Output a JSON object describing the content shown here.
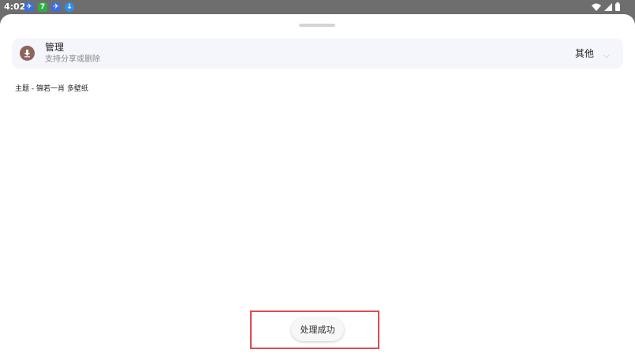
{
  "status_bar": {
    "time": "4:02",
    "notification_icons": [
      {
        "name": "app-bird-icon",
        "color": "#3d6fd8",
        "glyph": "✈"
      },
      {
        "name": "app-seven-icon",
        "color": "#2fae46",
        "glyph": "7"
      },
      {
        "name": "app-bird-icon",
        "color": "#3d6fd8",
        "glyph": "✈"
      },
      {
        "name": "app-download-icon",
        "color": "#2d8ff0",
        "glyph": "↓"
      }
    ],
    "system_icons": [
      "wifi-icon",
      "signal-icon",
      "battery-icon"
    ]
  },
  "manage": {
    "icon": "download-icon",
    "icon_color": "#8c655b",
    "title": "管理",
    "subtitle": "支持分享或删除",
    "category_value": "其他"
  },
  "path_text": "主题 - 锦若一肖  多壁纸",
  "toast": {
    "text": "处理成功",
    "highlight_color": "#e04b50"
  }
}
